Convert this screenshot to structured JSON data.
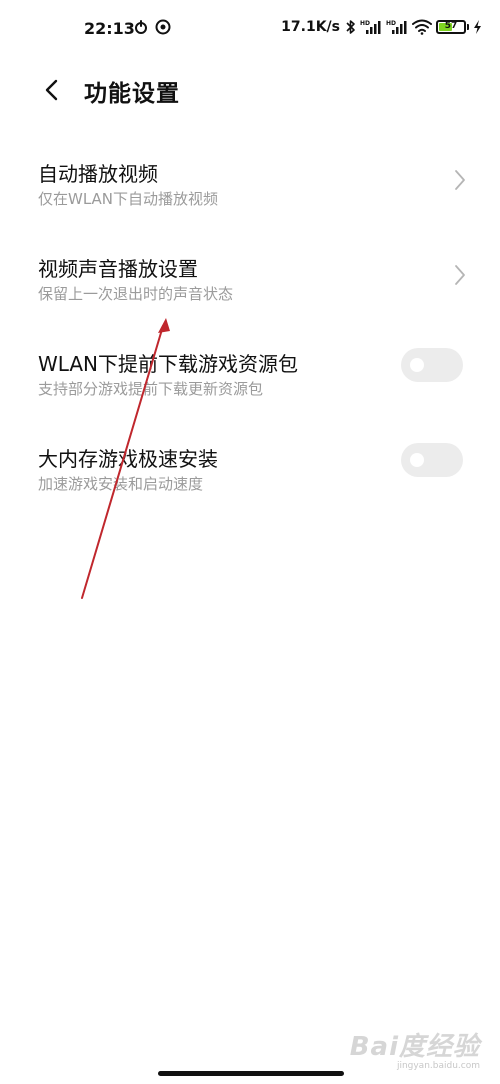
{
  "status_bar": {
    "time": "22:13",
    "net_speed": "17.1K/s",
    "battery_level": "57",
    "battery_percent": 57,
    "icons": [
      "sync-icon",
      "target-icon",
      "bluetooth-icon",
      "hd-signal-icon",
      "hd-signal-icon",
      "wifi-icon",
      "battery-icon",
      "charging-icon"
    ]
  },
  "header": {
    "title": "功能设置",
    "back_icon": "chevron-left-icon"
  },
  "settings": [
    {
      "title": "自动播放视频",
      "subtitle": "仅在WLAN下自动播放视频",
      "control": "chevron"
    },
    {
      "title": "视频声音播放设置",
      "subtitle": "保留上一次退出时的声音状态",
      "control": "chevron"
    },
    {
      "title": "WLAN下提前下载游戏资源包",
      "subtitle": "支持部分游戏提前下载更新资源包",
      "control": "toggle",
      "enabled": false
    },
    {
      "title": "大内存游戏极速安装",
      "subtitle": "加速游戏安装和启动速度",
      "control": "toggle",
      "enabled": false
    }
  ],
  "colors": {
    "title_text": "#111111",
    "subtitle_text": "#9b9b9b",
    "toggle_off": "#ececec",
    "battery_fill": "#7ed321",
    "annotation_arrow": "#c0272d"
  },
  "watermark": {
    "logo": "Bai度经验",
    "url": "jingyan.baidu.com"
  }
}
